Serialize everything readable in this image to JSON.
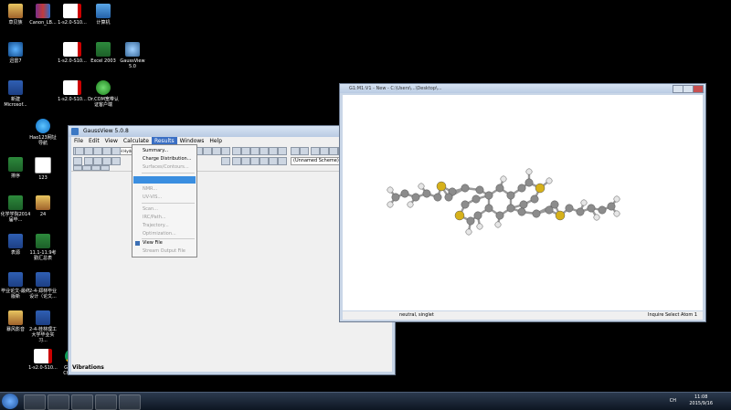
{
  "desktop": {
    "icons": [
      {
        "label": "草贝族",
        "icon": "img"
      },
      {
        "label": "Canon_LB...",
        "icon": "rar"
      },
      {
        "label": "1-s2.0-S10...",
        "icon": "pdf"
      },
      {
        "label": "计算机",
        "icon": "comp"
      },
      {
        "label": "迅雷7",
        "icon": "bird"
      },
      {
        "label": "1-s2.0-S10...",
        "icon": "pdf"
      },
      {
        "label": "Excel 2003",
        "icon": "excel"
      },
      {
        "label": "GaussView 5.0",
        "icon": "gv"
      },
      {
        "label": "新建 Microsof...",
        "icon": "word"
      },
      {
        "label": "1-s2.0-S10...",
        "icon": "pdf"
      },
      {
        "label": "Dr.COM宽带认证客户端",
        "icon": "dx"
      },
      {
        "label": "Hao123网址导航",
        "icon": "ie"
      },
      {
        "label": "排序",
        "icon": "excel"
      },
      {
        "label": "123",
        "icon": "doc"
      },
      {
        "label": "化学学院2014届毕...",
        "icon": "excel"
      },
      {
        "label": "24",
        "icon": "img"
      },
      {
        "label": "表源",
        "icon": "word"
      },
      {
        "label": "11.1-11.9考勤汇总表",
        "icon": "excel"
      },
      {
        "label": "毕业论文-最终版新",
        "icon": "word"
      },
      {
        "label": "2-4-郑林毕业设计（论文...",
        "icon": "word"
      },
      {
        "label": "暴风影音",
        "icon": "img"
      },
      {
        "label": "2-4-桂林理工大学毕业实习...",
        "icon": "word"
      },
      {
        "label": "1-s2.0-S10...",
        "icon": "pdf"
      },
      {
        "label": "Google Chrome",
        "icon": "chrome"
      },
      {
        "label": "hao123",
        "icon": "ie"
      }
    ]
  },
  "gaussview": {
    "title": "GaussView 5.0.8",
    "menu": [
      "File",
      "Edit",
      "View",
      "Calculate",
      "Results",
      "Windows",
      "Help"
    ],
    "active_menu": "Results",
    "dropdown_toolbar_value": "H Hydrogen",
    "dropdown_select_value": "(Unnamed Scheme)",
    "status_label": "Vibrations",
    "results_menu": [
      {
        "label": "Summary...",
        "enabled": true
      },
      {
        "label": "Charge Distribution...",
        "enabled": true
      },
      {
        "label": "Surfaces/Contours...",
        "enabled": false
      },
      {
        "label": "",
        "enabled": true,
        "selected": true
      },
      {
        "label": "NMR...",
        "enabled": false
      },
      {
        "label": "UV-VIS...",
        "enabled": false
      },
      {
        "label": "Scan...",
        "enabled": false
      },
      {
        "label": "IRC/Path...",
        "enabled": false
      },
      {
        "label": "Trajectory...",
        "enabled": false
      },
      {
        "label": "Optimization...",
        "enabled": false
      },
      {
        "label": "View File",
        "enabled": true
      },
      {
        "label": "Stream Output File",
        "enabled": false
      }
    ]
  },
  "viewer": {
    "title": "G1:M1:V1 - New - C:\\Users\\...\\Desktop\\...",
    "status_left": "neutral, singlet",
    "status_right": "Inquire Select Atom 1"
  },
  "taskbar": {
    "tray_text": "CH",
    "time": "11:08",
    "date": "2015/9/16"
  },
  "colors": {
    "desktop_bg": "#000000",
    "menu_highlight": "#3a8ee0",
    "sulfur": "#d6b11a",
    "carbon": "#8c8c8c",
    "hydrogen": "#e6e6e6"
  }
}
